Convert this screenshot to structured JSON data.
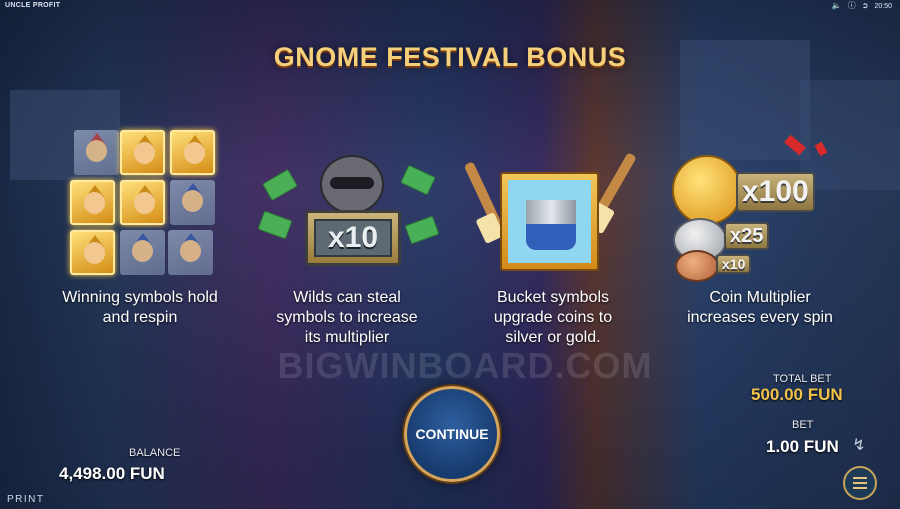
{
  "topbar": {
    "app_title": "UNCLE PROFIT",
    "clock": "20:50",
    "icons": [
      "sound-icon",
      "info-icon",
      "exit-icon"
    ]
  },
  "title": "GNOME FESTIVAL BONUS",
  "features": [
    {
      "icon": "gnome-grid-icon",
      "caption_line1": "Winning symbols hold",
      "caption_line2": "and respin",
      "caption_line3": ""
    },
    {
      "icon": "raccoon-wild-icon",
      "badge": "x10",
      "caption_line1": "Wilds can steal",
      "caption_line2": "symbols to increase",
      "caption_line3": "its multiplier"
    },
    {
      "icon": "paint-bucket-icon",
      "caption_line1": "Bucket symbols",
      "caption_line2": "upgrade coins to",
      "caption_line3": "silver or gold."
    },
    {
      "icon": "coin-multiplier-icon",
      "multipliers": [
        "x100",
        "x25",
        "x10"
      ],
      "caption_line1": "Coin Multiplier",
      "caption_line2": "increases every spin",
      "caption_line3": ""
    }
  ],
  "watermark": "BIGWINBOARD.COM",
  "continue_label": "CONTINUE",
  "balance": {
    "label": "BALANCE",
    "value": "4,498.00 FUN"
  },
  "total_bet": {
    "label": "TOTAL BET",
    "value": "500.00 FUN"
  },
  "bet": {
    "label": "BET",
    "value": "1.00 FUN"
  },
  "print_label": "PRINT",
  "colors": {
    "title_gold": "#f6d07a",
    "value_gold": "#f2c34a",
    "button_blue": "#173b6e"
  }
}
